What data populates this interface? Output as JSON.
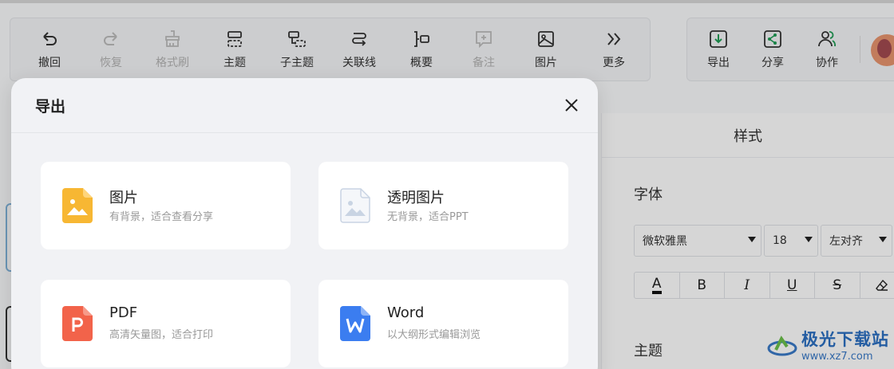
{
  "toolbar": {
    "undo": "撤回",
    "redo": "恢复",
    "format_brush": "格式刷",
    "topic": "主题",
    "subtopic": "子主题",
    "relation_line": "关联线",
    "summary": "概要",
    "note": "备注",
    "image": "图片",
    "more": "更多"
  },
  "actions": {
    "export": "导出",
    "share": "分享",
    "collab": "协作"
  },
  "style_panel": {
    "title": "样式",
    "font_section": "字体",
    "font_family": "微软雅黑",
    "font_size": "18",
    "align": "左对齐",
    "topic_section": "主题",
    "format_buttons": {
      "color": "A",
      "bold": "B",
      "italic": "I",
      "underline": "U",
      "strike": "S"
    }
  },
  "dialog": {
    "title": "导出",
    "close": "X",
    "options": [
      {
        "title": "图片",
        "desc": "有背景，适合查看分享",
        "icon": "image-file-icon",
        "color": "#f7b733"
      },
      {
        "title": "透明图片",
        "desc": "无背景，适合PPT",
        "icon": "transparent-image-icon",
        "color": "#c9d4e3"
      },
      {
        "title": "PDF",
        "desc": "高清矢量图，适合打印",
        "icon": "pdf-file-icon",
        "color": "#f2634a"
      },
      {
        "title": "Word",
        "desc": "以大纲形式编辑浏览",
        "icon": "word-file-icon",
        "color": "#3b7df0"
      }
    ]
  },
  "watermark": {
    "name": "极光下载站",
    "url": "www.xz7.com"
  }
}
